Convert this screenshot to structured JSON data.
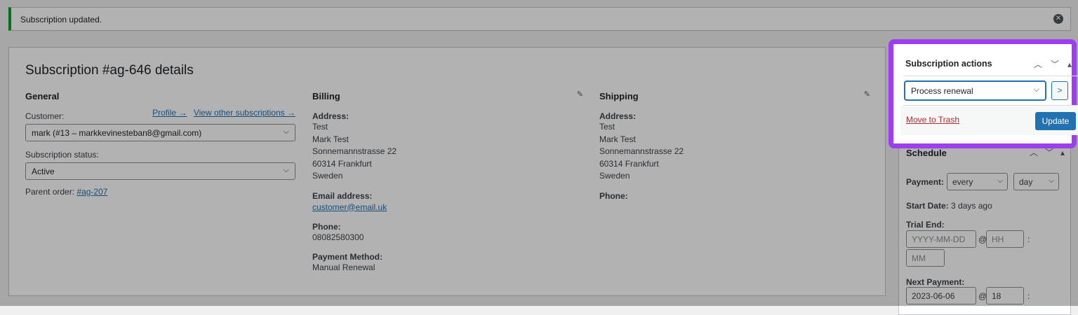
{
  "notice": {
    "text": "Subscription updated.",
    "dismiss_icon": "close-icon"
  },
  "panel": {
    "title": "Subscription #ag-646 details",
    "general": {
      "heading": "General",
      "customer_label": "Customer:",
      "profile_link": "Profile →",
      "other_subs_link": "View other subscriptions →",
      "customer_value": "mark (#13 – markkevinesteban8@gmail.com)",
      "status_label": "Subscription status:",
      "status_value": "Active",
      "parent_label": "Parent order:",
      "parent_link": "#ag-207"
    },
    "billing": {
      "heading": "Billing",
      "address_label": "Address:",
      "address_lines": [
        "Test",
        "Mark Test",
        "Sonnemannstrasse 22",
        "60314 Frankfurt",
        "Sweden"
      ],
      "email_label": "Email address:",
      "email_value": "customer@email.uk",
      "phone_label": "Phone:",
      "phone_value": "08082580300",
      "payment_label": "Payment Method:",
      "payment_value": "Manual Renewal"
    },
    "shipping": {
      "heading": "Shipping",
      "address_label": "Address:",
      "address_lines": [
        "Test",
        "Mark Test",
        "Sonnemannstrasse 22",
        "60314 Frankfurt",
        "Sweden"
      ],
      "phone_label": "Phone:"
    }
  },
  "actions": {
    "title": "Subscription actions",
    "selected_action": "Process renewal",
    "go_label": ">",
    "trash_label": "Move to Trash",
    "update_label": "Update"
  },
  "schedule": {
    "title": "Schedule",
    "payment_label": "Payment:",
    "interval_value": "every",
    "period_value": "day",
    "start_label": "Start Date:",
    "start_value": "3 days ago",
    "trial_label": "Trial End:",
    "trial_date_placeholder": "YYYY-MM-DD",
    "at_symbol": "@",
    "hour_placeholder": "HH",
    "colon": ":",
    "minute_placeholder": "MM",
    "next_label": "Next Payment:",
    "next_date": "2023-06-06",
    "next_hour": "18"
  }
}
